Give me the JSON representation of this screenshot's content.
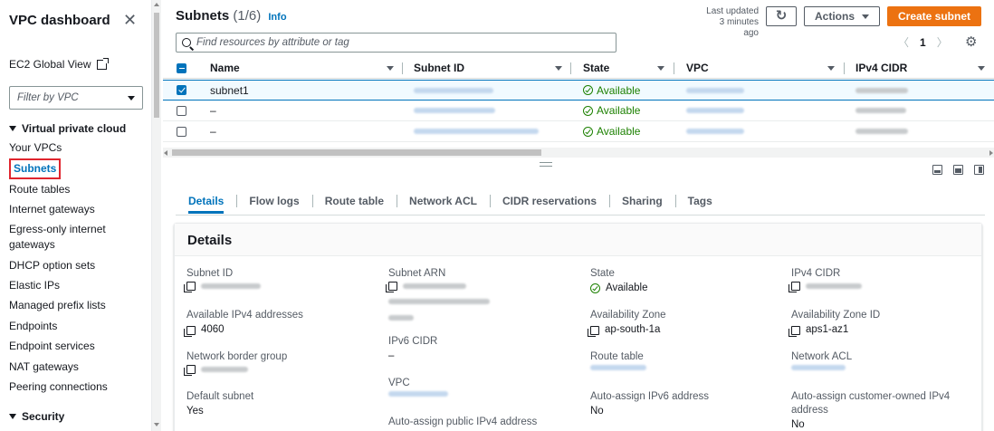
{
  "sidebar": {
    "title": "VPC dashboard",
    "ec2_link": "EC2 Global View",
    "filter_placeholder": "Filter by VPC",
    "section_vpc": "Virtual private cloud",
    "items": [
      "Your VPCs",
      "Subnets",
      "Route tables",
      "Internet gateways",
      "Egress-only internet",
      "gateways",
      "DHCP option sets",
      "Elastic IPs",
      "Managed prefix lists",
      "Endpoints",
      "Endpoint services",
      "NAT gateways",
      "Peering connections"
    ],
    "section_security": "Security"
  },
  "header": {
    "title": "Subnets",
    "count": "(1/6)",
    "info": "Info",
    "last_updated_1": "Last updated",
    "last_updated_2": "3 minutes ago",
    "actions": "Actions",
    "create": "Create subnet",
    "search_placeholder": "Find resources by attribute or tag",
    "page": "1"
  },
  "table": {
    "columns": [
      "Name",
      "Subnet ID",
      "State",
      "VPC",
      "IPv4 CIDR"
    ],
    "rows": [
      {
        "name": "subnet1",
        "state": "Available",
        "selected": true
      },
      {
        "name": "–",
        "state": "Available",
        "selected": false
      },
      {
        "name": "–",
        "state": "Available",
        "selected": false
      }
    ]
  },
  "tabs": [
    "Details",
    "Flow logs",
    "Route table",
    "Network ACL",
    "CIDR reservations",
    "Sharing",
    "Tags"
  ],
  "details": {
    "title": "Details",
    "subnet_id_label": "Subnet ID",
    "avail_ipv4_label": "Available IPv4 addresses",
    "avail_ipv4_value": "4060",
    "nbg_label": "Network border group",
    "default_subnet_label": "Default subnet",
    "default_subnet_value": "Yes",
    "subnet_arn_label": "Subnet ARN",
    "ipv6_cidr_label": "IPv6 CIDR",
    "ipv6_cidr_value": "–",
    "vpc_label": "VPC",
    "auto_ipv4_label": "Auto-assign public IPv4 address",
    "state_label": "State",
    "state_value": "Available",
    "az_label": "Availability Zone",
    "az_value": "ap-south-1a",
    "route_table_label": "Route table",
    "auto_ipv6_label": "Auto-assign IPv6 address",
    "auto_ipv6_value": "No",
    "ipv4_cidr_label": "IPv4 CIDR",
    "az_id_label": "Availability Zone ID",
    "az_id_value": "aps1-az1",
    "nacl_label": "Network ACL",
    "auto_owned_label_1": "Auto-assign customer-owned IPv4",
    "auto_owned_label_2": "address",
    "auto_owned_value": "No"
  },
  "colors": {
    "accent": "#0073bb",
    "primary_button": "#ec7211",
    "success": "#1d8102",
    "highlight": "#e0252e"
  }
}
